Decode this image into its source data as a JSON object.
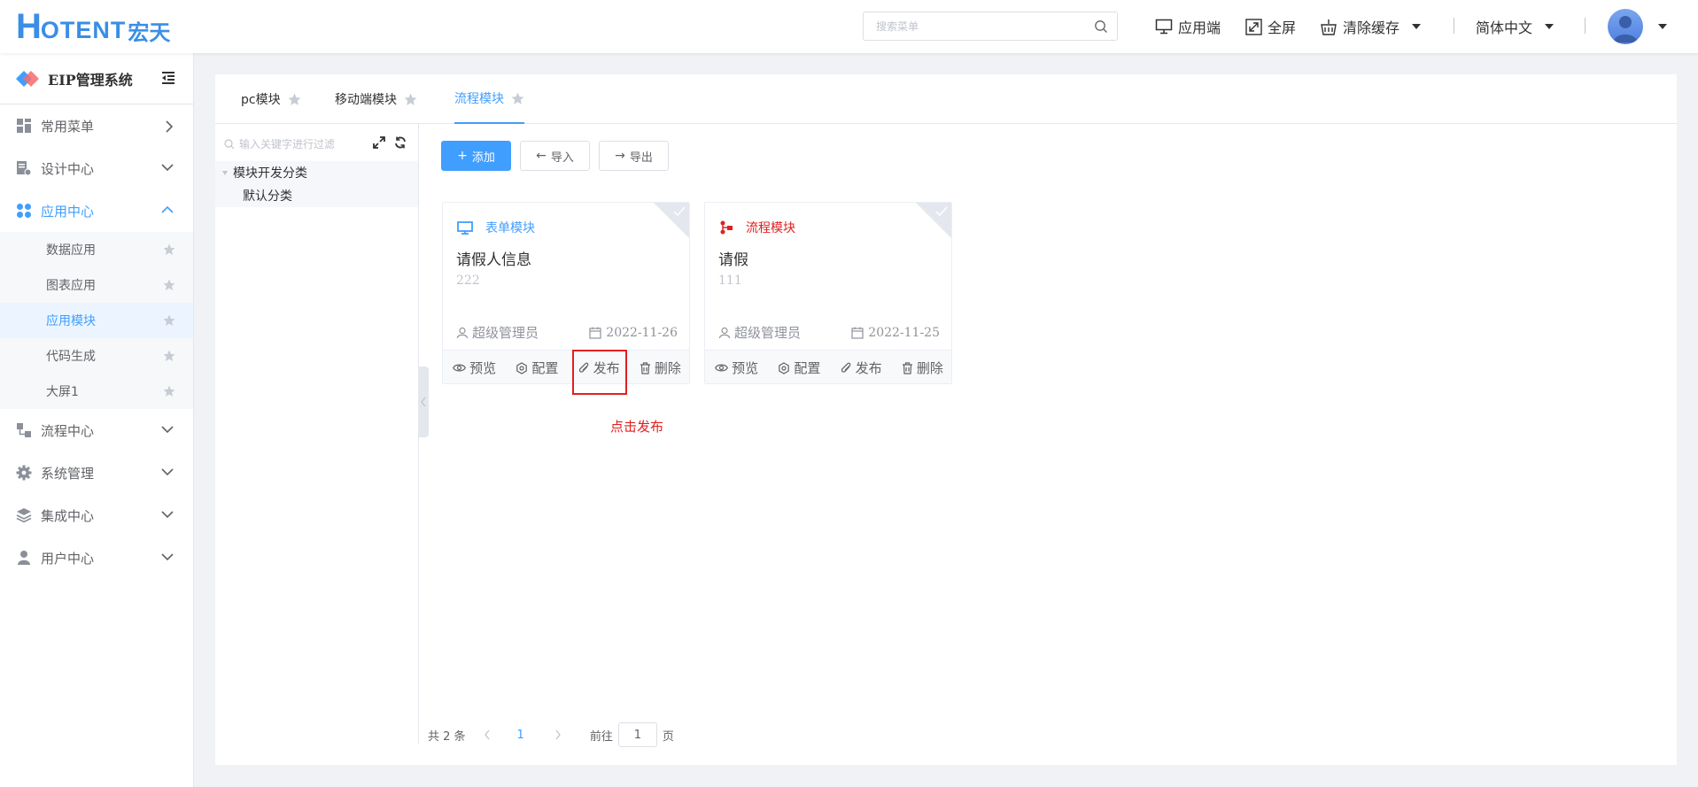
{
  "header": {
    "logo_h": "H",
    "logo_text": "OTENT",
    "logo_cn": "宏天",
    "search_placeholder": "搜索菜单",
    "app_label": "应用端",
    "fullscreen_label": "全屏",
    "clear_cache_label": "清除缓存",
    "language_label": "简体中文"
  },
  "sidebar": {
    "title": "EIP管理系统",
    "menus": [
      {
        "label": "常用菜单"
      },
      {
        "label": "设计中心"
      },
      {
        "label": "应用中心"
      },
      {
        "label": "流程中心"
      },
      {
        "label": "系统管理"
      },
      {
        "label": "集成中心"
      },
      {
        "label": "用户中心"
      }
    ],
    "app_center_items": [
      {
        "label": "数据应用"
      },
      {
        "label": "图表应用"
      },
      {
        "label": "应用模块"
      },
      {
        "label": "代码生成"
      },
      {
        "label": "大屏1"
      }
    ]
  },
  "tabs": [
    {
      "label": "pc模块"
    },
    {
      "label": "移动端模块"
    },
    {
      "label": "流程模块"
    }
  ],
  "tree": {
    "search_placeholder": "输入关键字进行过滤",
    "nodes": [
      {
        "label": "模块开发分类"
      },
      {
        "label": "默认分类"
      }
    ]
  },
  "toolbar": {
    "add_label": "添加",
    "import_label": "导入",
    "export_label": "导出"
  },
  "cards": [
    {
      "type": "表单模块",
      "name": "请假人信息",
      "desc": "222",
      "author": "超级管理员",
      "date": "2022-11-26"
    },
    {
      "type": "流程模块",
      "name": "请假",
      "desc": "111",
      "author": "超级管理员",
      "date": "2022-11-25"
    }
  ],
  "card_actions": {
    "preview": "预览",
    "config": "配置",
    "publish": "发布",
    "delete": "删除"
  },
  "annotation": "点击发布",
  "pagination": {
    "total": "共 2 条",
    "current": "1",
    "goto_prefix": "前往",
    "goto_value": "1",
    "goto_suffix": "页"
  },
  "colors": {
    "primary": "#409eff",
    "form_type": "#409eff",
    "flow_type": "#e02020",
    "highlight": "#e02020"
  }
}
